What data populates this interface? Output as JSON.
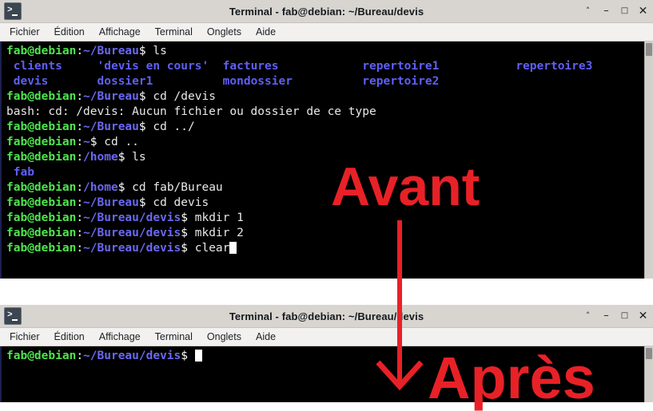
{
  "colors": {
    "titlebar_bg": "#d8d5d0",
    "menubar_bg": "#f2f1ef",
    "terminal_bg": "#000000",
    "prompt_user": "#4ee44e",
    "prompt_path": "#6a68f0",
    "directory": "#5f5ff5",
    "annotation_red": "#e82127"
  },
  "windows": [
    {
      "id": "window-1",
      "titlebar": {
        "icon": "terminal-icon",
        "title": "Terminal - fab@debian: ~/Bureau/devis",
        "buttons": [
          {
            "name": "shade-button",
            "glyph": "˄"
          },
          {
            "name": "minimize-button",
            "glyph": "–"
          },
          {
            "name": "maximize-button",
            "glyph": "□"
          },
          {
            "name": "close-button",
            "glyph": "✕"
          }
        ]
      },
      "menubar": [
        {
          "name": "menu-fichier",
          "label": "Fichier"
        },
        {
          "name": "menu-edition",
          "label": "Édition"
        },
        {
          "name": "menu-affichage",
          "label": "Affichage"
        },
        {
          "name": "menu-terminal",
          "label": "Terminal"
        },
        {
          "name": "menu-onglets",
          "label": "Onglets"
        },
        {
          "name": "menu-aide",
          "label": "Aide"
        }
      ],
      "terminal": {
        "lines": [
          {
            "type": "prompt",
            "user": "fab@debian",
            "path": "~/Bureau",
            "command": "ls"
          },
          {
            "type": "listing",
            "items": [
              "clients",
              "'devis en cours'",
              "factures",
              "repertoire1",
              "repertoire3"
            ]
          },
          {
            "type": "listing",
            "items": [
              "devis",
              "dossier1",
              "mondossier",
              "repertoire2"
            ]
          },
          {
            "type": "prompt",
            "user": "fab@debian",
            "path": "~/Bureau",
            "command": "cd /devis"
          },
          {
            "type": "error",
            "text": "bash: cd: /devis: Aucun fichier ou dossier de ce type"
          },
          {
            "type": "prompt",
            "user": "fab@debian",
            "path": "~/Bureau",
            "command": "cd ../"
          },
          {
            "type": "prompt",
            "user": "fab@debian",
            "path": "~",
            "command": "cd .."
          },
          {
            "type": "prompt",
            "user": "fab@debian",
            "path": "/home",
            "command": "ls"
          },
          {
            "type": "listing",
            "items": [
              "fab"
            ]
          },
          {
            "type": "prompt",
            "user": "fab@debian",
            "path": "/home",
            "command": "cd fab/Bureau"
          },
          {
            "type": "prompt",
            "user": "fab@debian",
            "path": "~/Bureau",
            "command": "cd devis"
          },
          {
            "type": "prompt",
            "user": "fab@debian",
            "path": "~/Bureau/devis",
            "command": "mkdir 1"
          },
          {
            "type": "prompt",
            "user": "fab@debian",
            "path": "~/Bureau/devis",
            "command": "mkdir 2"
          },
          {
            "type": "prompt",
            "user": "fab@debian",
            "path": "~/Bureau/devis",
            "command": "clear",
            "cursor": true
          }
        ]
      }
    },
    {
      "id": "window-2",
      "titlebar": {
        "icon": "terminal-icon",
        "title": "Terminal - fab@debian: ~/Bureau/devis",
        "buttons": [
          {
            "name": "shade-button",
            "glyph": "˄"
          },
          {
            "name": "minimize-button",
            "glyph": "–"
          },
          {
            "name": "maximize-button",
            "glyph": "□"
          },
          {
            "name": "close-button",
            "glyph": "✕"
          }
        ]
      },
      "menubar": [
        {
          "name": "menu-fichier",
          "label": "Fichier"
        },
        {
          "name": "menu-edition",
          "label": "Édition"
        },
        {
          "name": "menu-affichage",
          "label": "Affichage"
        },
        {
          "name": "menu-terminal",
          "label": "Terminal"
        },
        {
          "name": "menu-onglets",
          "label": "Onglets"
        },
        {
          "name": "menu-aide",
          "label": "Aide"
        }
      ],
      "terminal": {
        "lines": [
          {
            "type": "prompt",
            "user": "fab@debian",
            "path": "~/Bureau/devis",
            "command": "",
            "cursor": true
          }
        ]
      }
    }
  ],
  "annotations": {
    "before_label": "Avant",
    "after_label": "Après",
    "arrow": "down-arrow"
  }
}
